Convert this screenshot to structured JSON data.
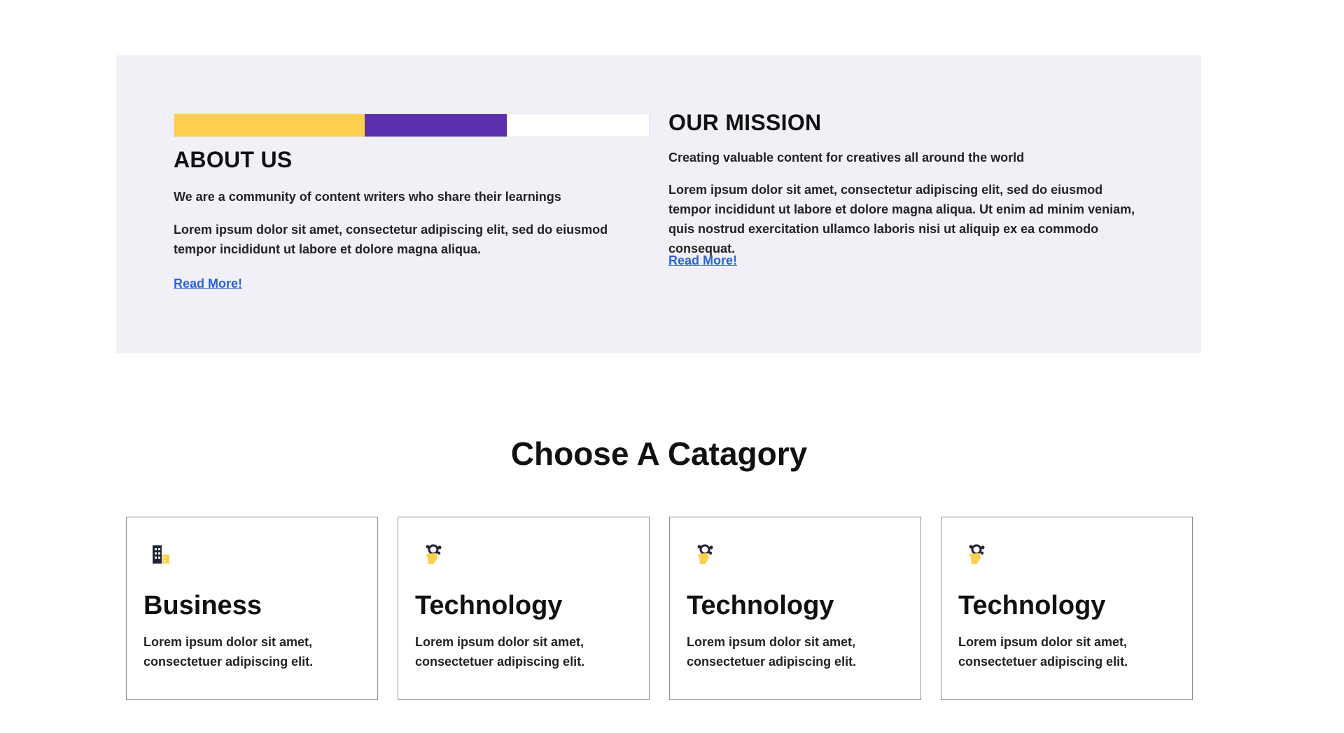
{
  "colors": {
    "panel_background": "#f2f0f7",
    "stripe_yellow": "#fcd04e",
    "stripe_purple": "#5b2fae",
    "stripe_white": "#ffffff",
    "link": "#2a63d6",
    "icon_dark": "#1f2533",
    "icon_yellow": "#fcd04e"
  },
  "about": {
    "heading": "ABOUT US",
    "tagline": "We are a community of content writers who share their learnings",
    "body": "Lorem ipsum dolor sit amet, consectetur adipiscing elit, sed do eiusmod tempor incididunt ut labore et dolore magna aliqua.",
    "read_more": "Read More!",
    "stripe_colors": [
      "yellow",
      "purple",
      "white"
    ]
  },
  "mission": {
    "heading": "OUR MISSION",
    "tagline": "Creating valuable content for creatives all around the world",
    "body": "Lorem ipsum dolor sit amet, consectetur adipiscing elit, sed do eiusmod tempor incididunt ut labore et dolore magna aliqua. Ut enim ad minim veniam, quis nostrud exercitation ullamco laboris nisi ut aliquip ex ea commodo consequat.",
    "read_more": "Read More!"
  },
  "categories": {
    "title": "Choose A Catagory",
    "items": [
      {
        "icon": "building-icon",
        "title": "Business",
        "description": "Lorem ipsum dolor sit amet, consectetuer adipiscing elit."
      },
      {
        "icon": "hand-gear-icon",
        "title": "Technology",
        "description": "Lorem ipsum dolor sit amet, consectetuer adipiscing elit."
      },
      {
        "icon": "hand-gear-icon",
        "title": "Technology",
        "description": "Lorem ipsum dolor sit amet, consectetuer adipiscing elit."
      },
      {
        "icon": "hand-gear-icon",
        "title": "Technology",
        "description": "Lorem ipsum dolor sit amet, consectetuer adipiscing elit."
      }
    ]
  }
}
